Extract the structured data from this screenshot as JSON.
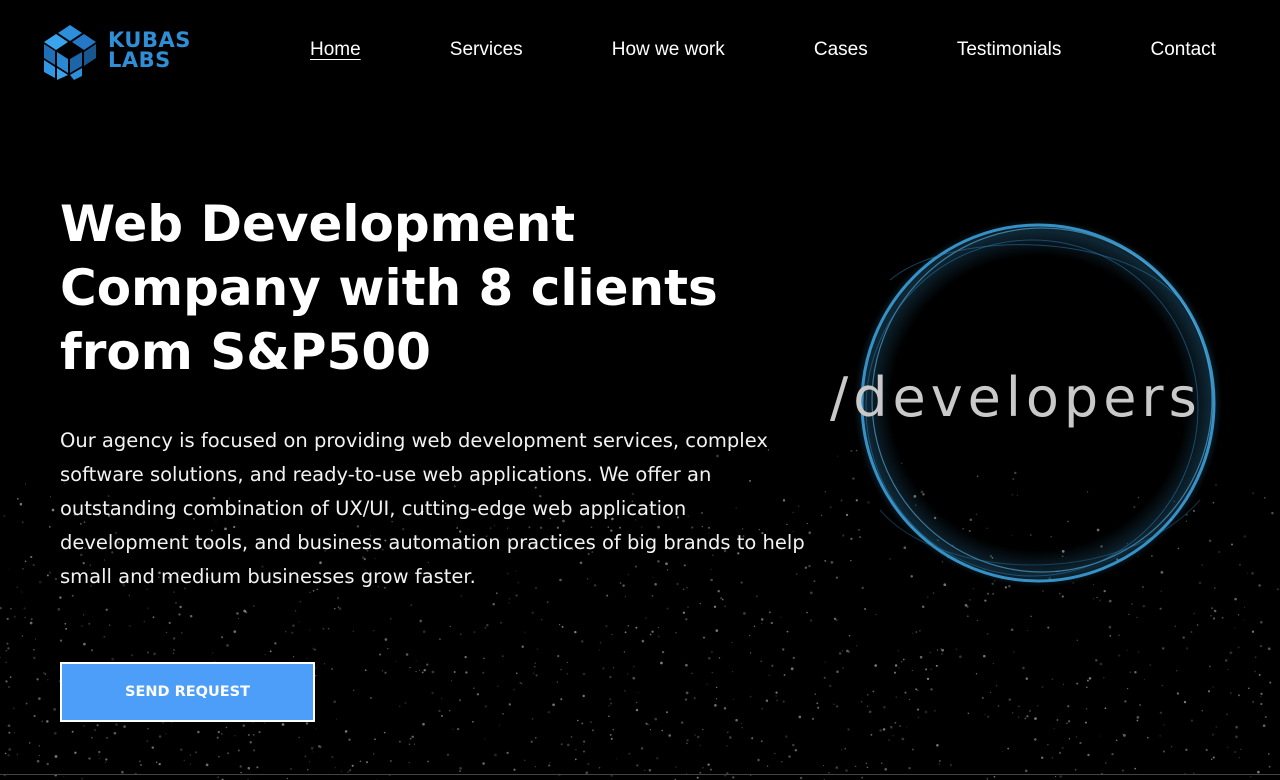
{
  "header": {
    "logo_line1": "KUBAS",
    "logo_line2": "LABS",
    "nav": [
      {
        "label": "Home",
        "active": true
      },
      {
        "label": "Services"
      },
      {
        "label": "How we work"
      },
      {
        "label": "Cases"
      },
      {
        "label": "Testimonials"
      },
      {
        "label": "Contact"
      }
    ]
  },
  "hero": {
    "title_line1": "Web Development",
    "title_line2": "Company with 8 clients",
    "title_line3": "from S&P500",
    "description": "Our agency is focused on providing web development services, complex software solutions, and ready-to-use web applications. We offer an outstanding combination of UX/UI, cutting-edge web application development tools, and business automation practices of big brands to help small and medium businesses grow faster.",
    "cta_label": "SEND REQUEST"
  },
  "graphic": {
    "word": "/developers"
  },
  "colors": {
    "background": "#000000",
    "accent": "#4c9ef8",
    "logo": "#2f8fd6",
    "ring": "#3b9fd8"
  },
  "icons": {
    "logo_mark": "cube-icon"
  }
}
